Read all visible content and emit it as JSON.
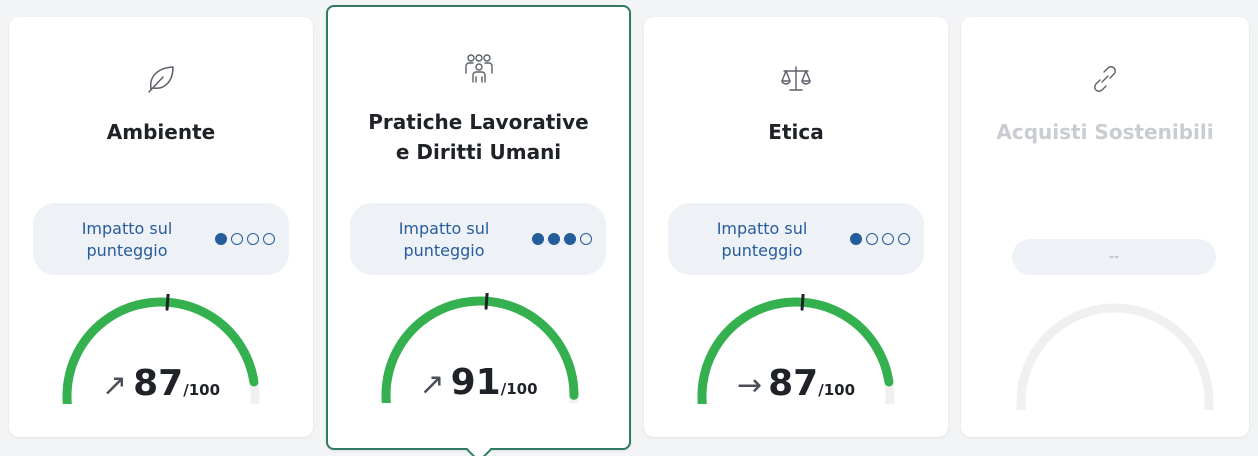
{
  "cards": [
    {
      "title_lines": [
        "Ambiente"
      ],
      "icon": "leaf-icon",
      "impact_label_lines": [
        "Impatto sul",
        "punteggio"
      ],
      "impact_level": 1,
      "impact_max": 4,
      "score": "87",
      "score_max": "/100",
      "trend": "↗",
      "trend_name": "trend-up-icon",
      "gauge_fraction": 0.87
    },
    {
      "title_lines": [
        "Pratiche Lavorative",
        "e Diritti Umani"
      ],
      "icon": "people-group-icon",
      "impact_label_lines": [
        "Impatto sul",
        "punteggio"
      ],
      "impact_level": 3,
      "impact_max": 4,
      "score": "91",
      "score_max": "/100",
      "trend": "↗",
      "trend_name": "trend-up-icon",
      "gauge_fraction": 0.91,
      "selected": true
    },
    {
      "title_lines": [
        "Etica"
      ],
      "icon": "scales-icon",
      "impact_label_lines": [
        "Impatto sul",
        "punteggio"
      ],
      "impact_level": 1,
      "impact_max": 4,
      "score": "87",
      "score_max": "/100",
      "trend": "→",
      "trend_name": "trend-flat-icon",
      "gauge_fraction": 0.87
    },
    {
      "title_lines": [
        "Acquisti Sostenibili"
      ],
      "icon": "chain-link-icon",
      "disabled": true,
      "impact_placeholder": "--"
    }
  ],
  "colors": {
    "gauge_fill": "#35b04f",
    "gauge_track": "#f0f0f0",
    "gauge_marker": "#1f2328",
    "impact_text": "#275c9c",
    "selected_border": "#2f7a62"
  }
}
